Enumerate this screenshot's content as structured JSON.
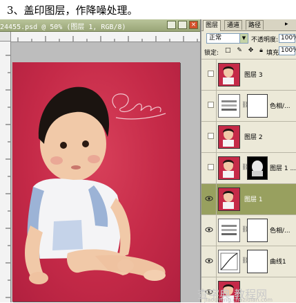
{
  "caption": "3、盖印图层，作降噪处理。",
  "document": {
    "title": "24455.psd @ 50% (图层 1, RGB/8)",
    "photo_signature": "Lilian"
  },
  "panel": {
    "tabs": [
      "图层",
      "通道",
      "路径"
    ],
    "blend_mode": "正常",
    "opacity_label": "不透明度:",
    "opacity_value": "100%",
    "lock_label": "锁定:",
    "fill_label": "填充:",
    "fill_value": "100%"
  },
  "layers": [
    {
      "name": "图层 3"
    },
    {
      "name": "色相/..."
    },
    {
      "name": "图层 2"
    },
    {
      "name": "图层 1 ..."
    },
    {
      "name": "图层 1"
    },
    {
      "name": "色相/..."
    },
    {
      "name": "曲线1"
    },
    {
      "name": ""
    }
  ],
  "watermark": {
    "text": "查字典 教程网",
    "url": "jiaocheng.chazidian.com"
  },
  "colors": {
    "photo_bg": "#c52a48",
    "selected_layer": "#98a05f",
    "title_bar": "#9aa678"
  }
}
